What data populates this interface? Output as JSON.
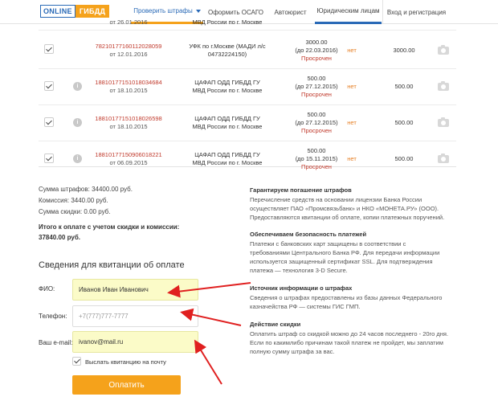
{
  "header": {
    "logo_online": "ONLINE",
    "logo_gibdd": "ГИБДД",
    "nav": [
      "Проверить штрафы",
      "Оформить ОСАГО",
      "Автоюрист",
      "Юридическим лицам",
      "Вход и регистрация"
    ]
  },
  "fines": [
    {
      "uin": "",
      "date": "от 26.01.2016",
      "org": [
        "МВД России по г. Москве"
      ],
      "amount": "",
      "until": "",
      "status": "",
      "discount": "",
      "total": ""
    },
    {
      "uin": "78210177160112028059",
      "date": "от 12.01.2016",
      "org": [
        "УФК по г.Москве (МАДИ л/с",
        "04732224150)"
      ],
      "amount": "3000.00",
      "until": "(до 22.03.2016)",
      "status": "Просрочен",
      "discount": "нет",
      "total": "3000.00"
    },
    {
      "uin": "18810177151018034684",
      "date": "от 18.10.2015",
      "org": [
        "ЦАФАП ОДД ГИБДД ГУ",
        "МВД России по г. Москве"
      ],
      "amount": "500.00",
      "until": "(до 27.12.2015)",
      "status": "Просрочен",
      "discount": "нет",
      "total": "500.00"
    },
    {
      "uin": "18810177151018026598",
      "date": "от 18.10.2015",
      "org": [
        "ЦАФАП ОДД ГИБДД ГУ",
        "МВД России по г. Москве"
      ],
      "amount": "500.00",
      "until": "(до 27.12.2015)",
      "status": "Просрочен",
      "discount": "нет",
      "total": "500.00"
    },
    {
      "uin": "18810177150906018221",
      "date": "от 06.09.2015",
      "org": [
        "ЦАФАП ОДД ГИБДД ГУ",
        "МВД России по г. Москве"
      ],
      "amount": "500.00",
      "until": "(до 15.11.2015)",
      "status": "Просрочен",
      "discount": "нет",
      "total": "500.00"
    }
  ],
  "summary": {
    "fines_sum": "Сумма штрафов: 34400.00 руб.",
    "commission": "Комиссия: 3440.00 руб.",
    "discount_sum": "Сумма скидки: 0.00 руб.",
    "total_label": "Итого к оплате с учетом скидки и комиссии:",
    "total_value": "37840.00 руб."
  },
  "form": {
    "title": "Сведения для квитанции об оплате",
    "name_label": "ФИО:",
    "name_value": "Иванов Иван Иванович",
    "phone_label": "Телефон:",
    "phone_placeholder": "+7(777)777-7777",
    "email_label": "Ваш e-mail:",
    "email_value": "ivanov@mail.ru",
    "send_label": "Выслать квитанцию на почту",
    "pay_label": "Оплатить"
  },
  "info": [
    {
      "title": "Гарантируем погашение штрафов",
      "lines": [
        "Перечисление средств на основании лицензии Банка России",
        "осуществляет ПАО «Промсвязьбанк» и НКО «МОНЕТА.РУ» (ООО).",
        "Предоставляются квитанции об оплате, копии платежных поручений."
      ]
    },
    {
      "title": "Обеспечиваем безопасность платежей",
      "lines": [
        "Платежи с банковских карт защищены в соответствии с",
        "требованиями Центрального Банка РФ. Для передачи информации",
        "используется защищенный сертификат SSL. Для подтверждения",
        "платежа — технология 3-D Secure."
      ]
    },
    {
      "title": "Источник информации о штрафах",
      "lines": [
        "Сведения о штрафах предоставлены из базы данных Федерального",
        "казначейства РФ — системы ГИС ГМП."
      ]
    },
    {
      "title": "Действие скидки",
      "lines": [
        "Оплатить штраф со скидкой можно до 24 часов последнего - 20го дня.",
        "Если по какимлибо причинам такой платеж не пройдет, мы заплатим",
        "полную сумму штрафа за вас."
      ]
    }
  ],
  "colors": {
    "accent": "#f5a21b",
    "brand": "#2a6ab7",
    "alert": "#c0392b",
    "arrow": "#e02020"
  }
}
